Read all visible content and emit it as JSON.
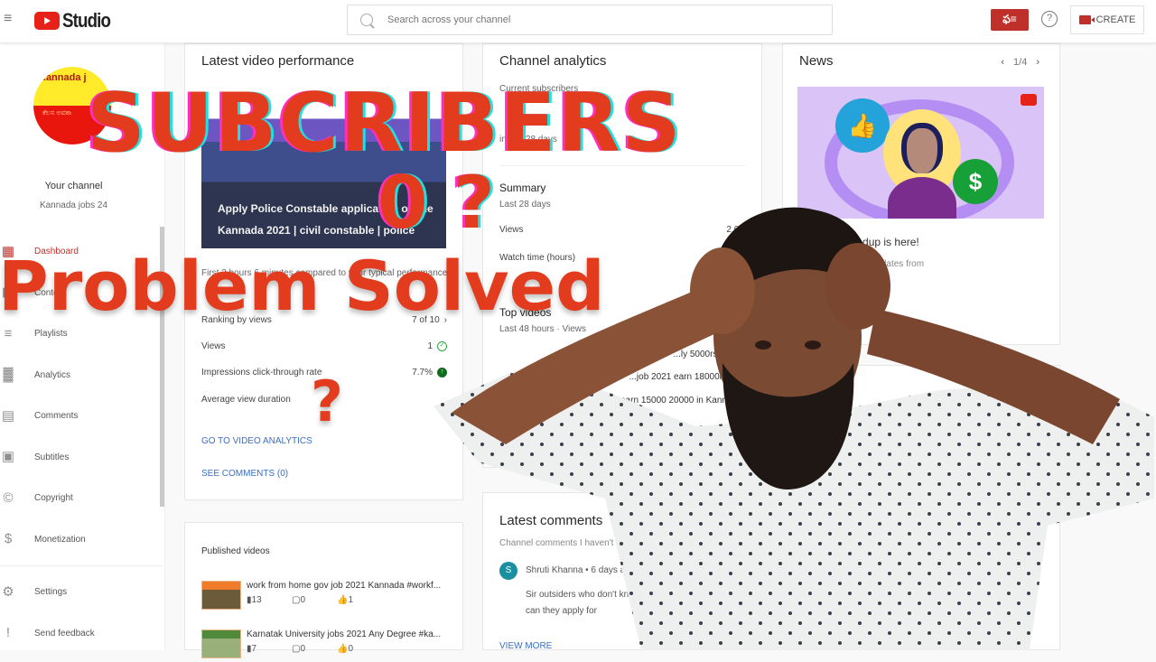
{
  "header": {
    "app_name": "Studio",
    "search_placeholder": "Search across your channel",
    "switch_account_label": "ఫ≡",
    "help_label": "?",
    "create_label": "CREATE"
  },
  "sidebar": {
    "avatar_top_text": "Kannada j",
    "avatar_bottom_text": "ಕೆಲಸ ಅವಕಾ",
    "channel_label": "Your channel",
    "channel_name": "Kannada jobs 24",
    "items": [
      {
        "label": "Dashboard",
        "icon": "dashboard-icon",
        "glyph": "▦",
        "active": true
      },
      {
        "label": "Content",
        "icon": "content-icon",
        "glyph": "▶",
        "active": false
      },
      {
        "label": "Playlists",
        "icon": "playlists-icon",
        "glyph": "≡",
        "active": false
      },
      {
        "label": "Analytics",
        "icon": "analytics-icon",
        "glyph": "▓",
        "active": false
      },
      {
        "label": "Comments",
        "icon": "comments-icon",
        "glyph": "▤",
        "active": false
      },
      {
        "label": "Subtitles",
        "icon": "subtitles-icon",
        "glyph": "▣",
        "active": false
      },
      {
        "label": "Copyright",
        "icon": "copyright-icon",
        "glyph": "©",
        "active": false
      },
      {
        "label": "Monetization",
        "icon": "monetization-icon",
        "glyph": "$",
        "active": false
      }
    ],
    "footer_items": [
      {
        "label": "Settings",
        "icon": "settings-icon",
        "glyph": "⚙"
      },
      {
        "label": "Send feedback",
        "icon": "feedback-icon",
        "glyph": "!"
      }
    ]
  },
  "latest_video": {
    "title": "Latest video performance",
    "thumb_line1": "Apply Police Constable application online",
    "thumb_line2": "Kannada 2021 | civil constable | police",
    "note": "First 3 hours 6 minutes compared to your typical performance",
    "ranking_label": "Ranking by views",
    "ranking_value": "7 of 10",
    "stats": [
      {
        "label": "Views",
        "value": "1",
        "status": "ok"
      },
      {
        "label": "Impressions click-through rate",
        "value": "7.7%",
        "status": "good"
      },
      {
        "label": "Average view duration",
        "value": "",
        "status": ""
      }
    ],
    "link_analytics": "GO TO VIDEO ANALYTICS",
    "link_comments": "SEE COMMENTS (0)"
  },
  "published": {
    "title": "Published videos",
    "items": [
      {
        "title": "work from home gov job 2021 Kannada #workf...",
        "views": "13",
        "comments": "0",
        "likes": "1"
      },
      {
        "title": "Karnatak University jobs 2021 Any Degree #ka...",
        "views": "7",
        "comments": "0",
        "likes": "0"
      }
    ]
  },
  "channel_analytics": {
    "title": "Channel analytics",
    "current_subs_label": "Current subscribers",
    "current_subs_value": "",
    "subs_change": "in last 28 days",
    "summary_title": "Summary",
    "summary_period": "Last 28 days",
    "rows": [
      {
        "label": "Views",
        "value": "2.0K"
      },
      {
        "label": "Watch time (hours)",
        "value": ""
      }
    ],
    "top_videos_title": "Top videos",
    "top_videos_sub": "Last 48 hours · Views",
    "top_videos": [
      "...ly 5000rs in",
      "...job 2021 earn 18000rs",
      "...job 2021 earn 15000 20000 in Kann"
    ]
  },
  "latest_comments": {
    "title": "Latest comments",
    "subtitle": "Channel comments I haven't responded to",
    "author_initial": "S",
    "author": "Shruti Khanna • 6 days ago",
    "text": "Sir outsiders who don't know language can they apply for",
    "view_more": "VIEW MORE"
  },
  "news": {
    "title": "News",
    "pager": "1/4",
    "headline": "Creator Roundup is here!",
    "text": "Creator news and updates from"
  },
  "overlay": {
    "line1": "SUBCRIBERS",
    "line2": "0 ?",
    "line3": "Problem Solved",
    "line4": "?"
  },
  "colors": {
    "brand_red": "#e62117",
    "overlay_red": "#e23b1d",
    "link_blue": "#3b6fc2",
    "ok_green": "#2ba640"
  }
}
